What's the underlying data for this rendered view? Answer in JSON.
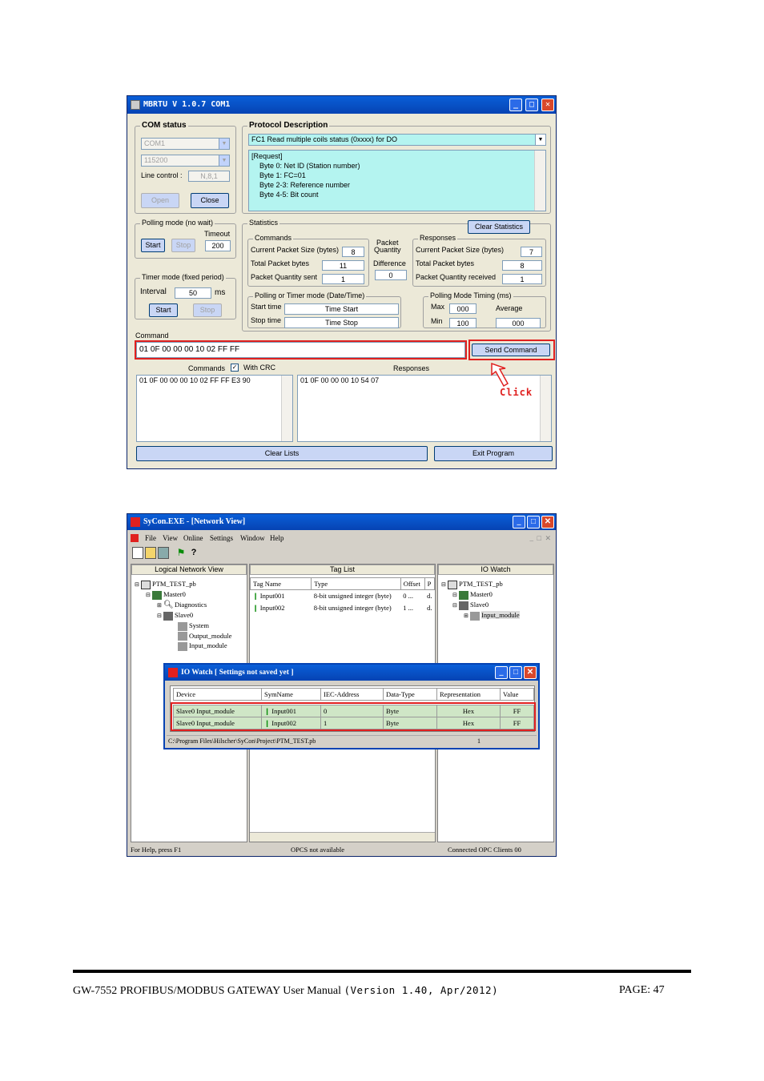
{
  "mbrtu": {
    "title": "MBRTU V 1.0.7 COM1",
    "com_status": {
      "label": "COM status",
      "port": "COM1",
      "baud": "115200",
      "line_control_label": "Line control :",
      "line_control": "N,8,1",
      "open": "Open",
      "close": "Close"
    },
    "protocol": {
      "label": "Protocol Description",
      "selected": "FC1  Read multiple coils status (0xxxx)  for DO",
      "lines": [
        "[Request]",
        "Byte 0:      Net ID (Station number)",
        "Byte 1:      FC=01",
        "Byte 2-3:     Reference number",
        "Byte 4-5:    Bit count"
      ]
    },
    "polling": {
      "label": "Polling mode (no wait)",
      "timeout_label": "Timeout",
      "timeout": "200",
      "start": "Start",
      "stop": "Stop"
    },
    "timer": {
      "label": "Timer mode (fixed period)",
      "interval_label": "Interval",
      "interval": "50",
      "unit": "ms",
      "start": "Start",
      "stop": "Stop"
    },
    "statistics": {
      "label": "Statistics",
      "clear": "Clear Statistics",
      "commands_label": "Commands",
      "cps_label": "Current Packet Size (bytes)",
      "cps": "8",
      "tpb_label": "Total Packet bytes",
      "tpb": "11",
      "pqs_label": "Packet Quantity sent",
      "pqs": "1",
      "pq_label1": "Packet",
      "pq_label2": "Quantity",
      "diff_label": "Difference",
      "diff": "0",
      "responses_label": "Responses",
      "rcps_label": "Current Packet Size (bytes)",
      "rcps": "7",
      "rtpb_label": "Total Packet bytes",
      "rtpb": "8",
      "rpqr_label": "Packet Quantity received",
      "rpqr": "1",
      "ptm_label": "Polling or Timer mode  (Date/Time)",
      "start_time_label": "Start time",
      "start_time": "Time Start",
      "stop_time_label": "Stop time",
      "stop_time": "Time Stop",
      "pmt_label": "Polling Mode Timing (ms)",
      "max_label": "Max",
      "max": "000",
      "min_label": "Min",
      "min": "100",
      "avg_label": "Average",
      "avg": "000"
    },
    "command_label": "Command",
    "command": "01 0F 00 00 00 10 02 FF FF",
    "send": "Send Command",
    "commands_list_label": "Commands",
    "with_crc": "With CRC",
    "responses_list_label": "Responses",
    "commands_list": "01 0F 00 00 00 10 02 FF FF E3 90",
    "responses_list": "01 0F 00 00 00 10 54 07",
    "click": "Click",
    "clear_lists": "Clear Lists",
    "exit": "Exit Program"
  },
  "sycon": {
    "title": "SyCon.EXE - [Network View]",
    "menu": [
      "File",
      "View",
      "Online",
      "Settings",
      "Window",
      "Help"
    ],
    "panes": {
      "logical": "Logical Network View",
      "tags": "Tag List",
      "io": "IO Watch"
    },
    "tree": [
      "PTM_TEST_pb",
      "Master0",
      "Diagnostics",
      "Slave0",
      "System",
      "Output_module",
      "Input_module"
    ],
    "tag_headers": [
      "Tag Name",
      "Type",
      "Offset",
      "P"
    ],
    "tag_rows": [
      [
        "Input001",
        "8-bit unsigned integer (byte)",
        "0 ...",
        "d."
      ],
      [
        "Input002",
        "8-bit unsigned integer (byte)",
        "1 ...",
        "d."
      ]
    ],
    "io_tree": [
      "PTM_TEST_pb",
      "Master0",
      "Slave0",
      "Input_module"
    ],
    "status": [
      "For Help, press F1",
      "OPCS not available",
      "Connected OPC Clients 00"
    ]
  },
  "iowatch": {
    "title": "IO Watch [ Settings not saved yet ]",
    "headers": [
      "Device",
      "SymName",
      "IEC-Address",
      "Data-Type",
      "Representation",
      "Value"
    ],
    "rows": [
      [
        "Slave0 Input_module",
        "Input001",
        "0",
        "Byte",
        "Hex",
        "FF"
      ],
      [
        "Slave0 Input_module",
        "Input002",
        "1",
        "Byte",
        "Hex",
        "FF"
      ]
    ],
    "path": "C:\\Program Files\\Hilscher\\SyCon\\Project\\PTM_TEST.pb",
    "count": "1"
  },
  "footer": {
    "manual": "GW-7552 PROFIBUS/MODBUS GATEWAY User Manual",
    "version": "(Version 1.40, Apr/2012)",
    "page": "PAGE: 47"
  }
}
